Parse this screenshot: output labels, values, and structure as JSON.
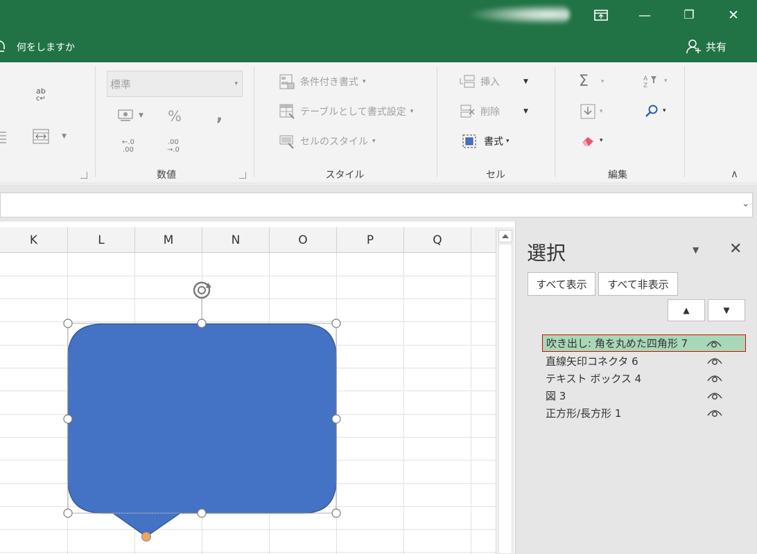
{
  "window": {
    "restore_icon": "ribbon-display-options-icon",
    "minimize_symbol": "—",
    "maximize_symbol": "❐",
    "close_symbol": "✕"
  },
  "tellme": {
    "text": "何をしますか",
    "icon": "lightbulb-icon"
  },
  "share": {
    "label": "共有",
    "icon": "person-add-icon"
  },
  "ribbon": {
    "number": {
      "format_value": "標準",
      "percent": "%",
      "comma": ",",
      "increase_decimal_top": "←.0",
      "increase_decimal_bottom": ".00",
      "decrease_decimal_top": ".00",
      "decrease_decimal_bottom": "→.0",
      "group_label": "数値"
    },
    "styles": {
      "conditional": "条件付き書式",
      "table": "テーブルとして書式設定",
      "cell": "セルのスタイル",
      "group_label": "スタイル"
    },
    "cells": {
      "insert": "挿入",
      "delete": "削除",
      "format": "書式",
      "group_label": "セル"
    },
    "editing": {
      "sum_symbol": "Σ",
      "group_label": "編集"
    },
    "alignment": {
      "wrap_text": "ab"
    },
    "collapse_symbol": "∧"
  },
  "grid": {
    "columns": [
      "K",
      "L",
      "M",
      "N",
      "O",
      "P",
      "Q"
    ]
  },
  "selection_pane": {
    "title": "選択",
    "menu_caret": "▼",
    "close_symbol": "✕",
    "show_all": "すべて表示",
    "hide_all": "すべて非表示",
    "move_up": "▲",
    "move_down": "▼",
    "items": [
      {
        "label": "吹き出し: 角を丸めた四角形 7",
        "selected": true
      },
      {
        "label": "直線矢印コネクタ 6",
        "selected": false
      },
      {
        "label": "テキスト ボックス 4",
        "selected": false
      },
      {
        "label": "図 3",
        "selected": false
      },
      {
        "label": "正方形/長方形 1",
        "selected": false
      }
    ]
  },
  "colors": {
    "excel_green": "#217346",
    "shape_fill": "#4472c4",
    "shape_border": "#2f528f",
    "adjust_handle": "#f4a460",
    "selected_item_bg": "#a7d8b8",
    "selected_item_border": "#e00000"
  }
}
